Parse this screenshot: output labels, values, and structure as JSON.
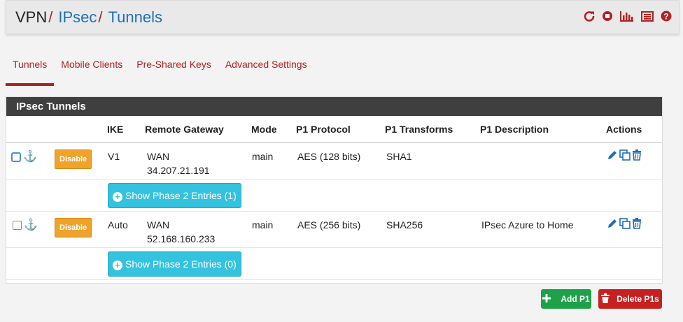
{
  "breadcrumb": {
    "home": "VPN",
    "sep": "/",
    "ipsec": "IPsec",
    "tunnels": "Tunnels"
  },
  "header_icons": [
    "restart-icon",
    "stop-icon",
    "chart-icon",
    "list-icon",
    "help-icon"
  ],
  "tabs": [
    {
      "label": "Tunnels",
      "active": true
    },
    {
      "label": "Mobile Clients",
      "active": false
    },
    {
      "label": "Pre-Shared Keys",
      "active": false
    },
    {
      "label": "Advanced Settings",
      "active": false
    }
  ],
  "panel": {
    "title": "IPsec Tunnels",
    "columns": [
      "IKE",
      "Remote Gateway",
      "Mode",
      "P1 Protocol",
      "P1 Transforms",
      "P1 Description",
      "Actions"
    ],
    "rows": [
      {
        "disable_label": "Disable",
        "ike": "V1",
        "gateway_if": "WAN",
        "gateway_ip": "34.207.21.191",
        "mode": "main",
        "protocol": "AES (128 bits)",
        "transforms": "SHA1",
        "description": "",
        "phase2_label": "Show Phase 2 Entries (1)"
      },
      {
        "disable_label": "Disable",
        "ike": "Auto",
        "gateway_if": "WAN",
        "gateway_ip": "52.168.160.233",
        "mode": "main",
        "protocol": "AES (256 bits)",
        "transforms": "SHA256",
        "description": "IPsec Azure to Home",
        "phase2_label": "Show Phase 2 Entries (0)"
      }
    ]
  },
  "buttons": {
    "add": "Add P1",
    "delete": "Delete P1s"
  },
  "colors": {
    "accent": "#b52020",
    "link": "#1f6fb8",
    "add": "#1fa14a",
    "delete": "#c72020",
    "phase2": "#34c3de",
    "disable": "#f0a32b"
  }
}
